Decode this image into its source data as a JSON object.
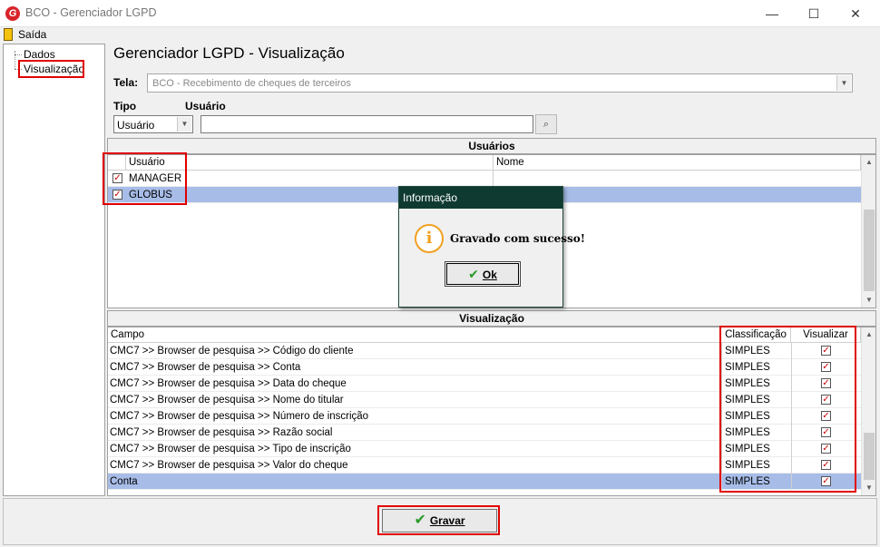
{
  "window": {
    "title": "BCO - Gerenciador LGPD",
    "logo_letter": "G",
    "minimize": "—",
    "maximize": "☐",
    "close": "✕"
  },
  "menu": {
    "exit": "Saída"
  },
  "tree": {
    "items": [
      {
        "label": "Dados"
      },
      {
        "label": "Visualização"
      }
    ]
  },
  "header": {
    "title": "Gerenciador LGPD - Visualização",
    "tela_label": "Tela:",
    "tela_value": "BCO - Recebimento de cheques de terceiros",
    "tipo_label": "Tipo",
    "usuario_label": "Usuário",
    "tipo_value": "Usuário",
    "usuario_value": ""
  },
  "users": {
    "title": "Usuários",
    "columns": [
      "Usuário",
      "Nome"
    ],
    "rows": [
      {
        "user": "MANAGER",
        "name": "",
        "checked": true
      },
      {
        "user": "GLOBUS",
        "name": "",
        "checked": true,
        "selected": true
      }
    ]
  },
  "visualizacao": {
    "title": "Visualização",
    "columns": [
      "Campo",
      "Classificação",
      "Visualizar"
    ],
    "rows": [
      {
        "campo": "CMC7 >> Browser de pesquisa >> Código do cliente",
        "classificacao": "SIMPLES",
        "visualizar": true
      },
      {
        "campo": "CMC7 >> Browser de pesquisa >> Conta",
        "classificacao": "SIMPLES",
        "visualizar": true
      },
      {
        "campo": "CMC7 >> Browser de pesquisa >> Data do cheque",
        "classificacao": "SIMPLES",
        "visualizar": true
      },
      {
        "campo": "CMC7 >> Browser de pesquisa >> Nome do titular",
        "classificacao": "SIMPLES",
        "visualizar": true
      },
      {
        "campo": "CMC7 >> Browser de pesquisa >> Número de inscrição",
        "classificacao": "SIMPLES",
        "visualizar": true
      },
      {
        "campo": "CMC7 >> Browser de pesquisa >> Razão social",
        "classificacao": "SIMPLES",
        "visualizar": true
      },
      {
        "campo": "CMC7 >> Browser de pesquisa >> Tipo de inscrição",
        "classificacao": "SIMPLES",
        "visualizar": true
      },
      {
        "campo": "CMC7 >> Browser de pesquisa >> Valor do cheque",
        "classificacao": "SIMPLES",
        "visualizar": true
      },
      {
        "campo": "Conta",
        "classificacao": "SIMPLES",
        "visualizar": true,
        "selected": true
      }
    ]
  },
  "footer": {
    "save_label": "Gravar"
  },
  "dialog": {
    "title": "Informação",
    "message": "Gravado com sucesso!",
    "ok_label": "Ok",
    "icon": "info-icon"
  },
  "colors": {
    "highlight": "#e00000",
    "selection": "#a7bde8",
    "dialog_title": "#0f3a32"
  }
}
